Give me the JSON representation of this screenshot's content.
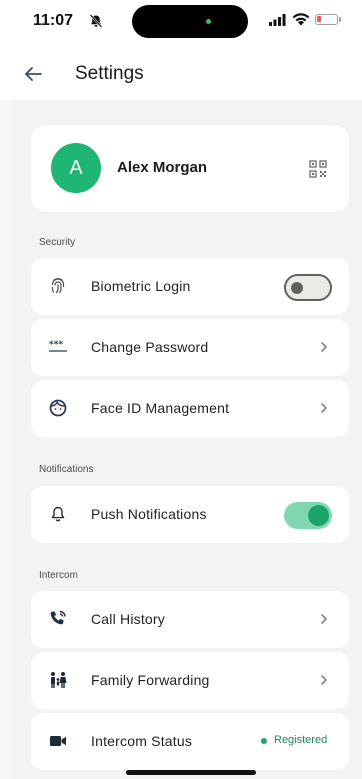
{
  "status_bar": {
    "time": "11:07",
    "icons": [
      "bell-off-icon",
      "signal-icon",
      "wifi-icon",
      "battery-low-icon"
    ]
  },
  "header": {
    "title": "Settings",
    "back_icon": "arrow-left-icon"
  },
  "profile": {
    "initial": "A",
    "name": "Alex Morgan",
    "qr_icon": "qr-code-icon"
  },
  "sections": {
    "security": {
      "title": "Security",
      "items": [
        {
          "label": "Biometric Login",
          "icon": "fingerprint-icon",
          "control": "toggle",
          "enabled": false
        },
        {
          "label": "Change Password",
          "icon": "password-icon",
          "control": "chevron"
        },
        {
          "label": "Face ID Management",
          "icon": "face-icon",
          "control": "chevron"
        }
      ]
    },
    "notifications": {
      "title": "Notifications",
      "items": [
        {
          "label": "Push Notifications",
          "icon": "bell-icon",
          "control": "toggle",
          "enabled": true
        }
      ]
    },
    "intercom": {
      "title": "Intercom",
      "items": [
        {
          "label": "Call History",
          "icon": "phone-history-icon",
          "control": "chevron"
        },
        {
          "label": "Family Forwarding",
          "icon": "family-icon",
          "control": "chevron"
        },
        {
          "label": "Intercom Status",
          "icon": "video-camera-icon",
          "status": "Registered"
        }
      ]
    }
  },
  "colors": {
    "accent": "#1fb573",
    "toggle_on_track": "#7fd6b0",
    "toggle_on_knob": "#1aa668",
    "status_ok": "#1aa668",
    "battery_low": "#f2545b",
    "background": "#f3f3f3",
    "card": "#ffffff"
  }
}
